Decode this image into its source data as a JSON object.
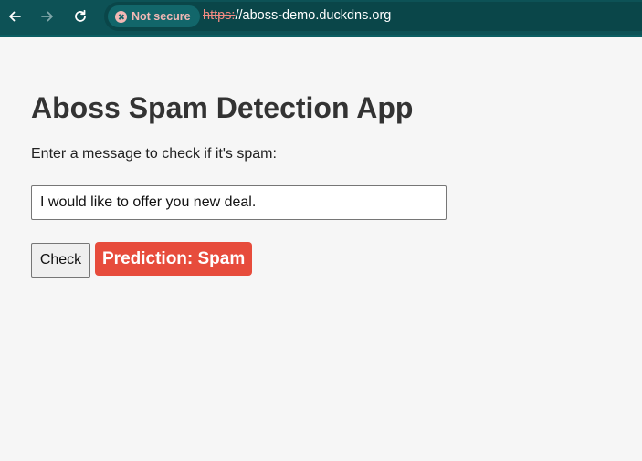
{
  "browser": {
    "security_label": "Not secure",
    "url_scheme": "https:",
    "url_rest": "//aboss-demo.duckdns.org",
    "theme_color": "#0d5256"
  },
  "page": {
    "title": "Aboss Spam Detection App",
    "prompt": "Enter a message to check if it's spam:",
    "message_value": "I would like to offer you new deal.",
    "check_label": "Check",
    "result_text": "Prediction: Spam",
    "result_color": "#e74c3c"
  },
  "icons": {
    "back": "arrow-left-icon",
    "forward": "arrow-right-icon",
    "reload": "reload-icon",
    "security": "not-secure-icon"
  }
}
